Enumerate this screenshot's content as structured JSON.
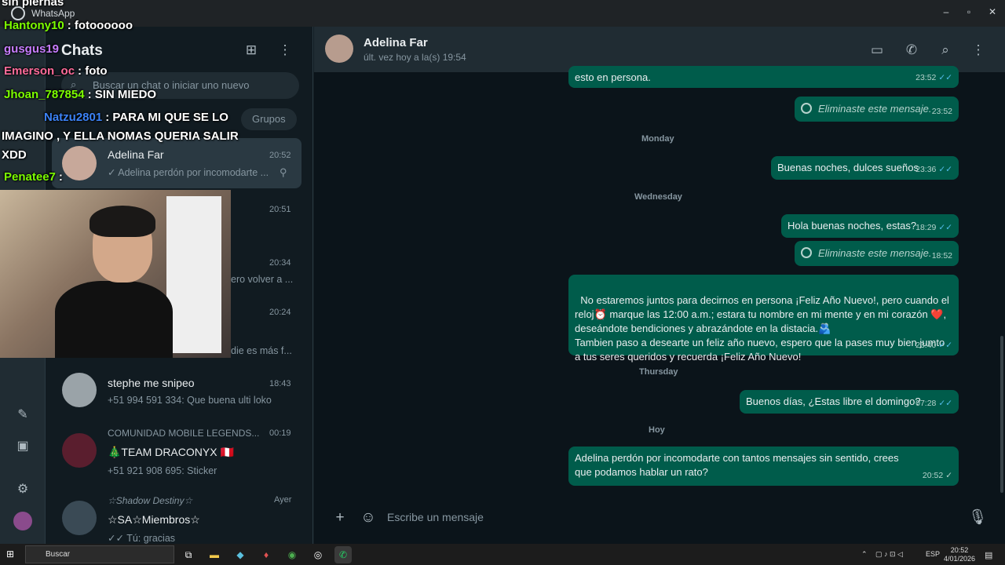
{
  "window": {
    "title": "WhatsApp"
  },
  "sidebar": {
    "title": "Chats",
    "search_placeholder": "Buscar un chat o iniciar uno nuevo",
    "filters": [
      "Grupos"
    ],
    "chats": [
      {
        "name": "Adelina Far",
        "time": "20:52",
        "last": "✓ Adelina perdón por incomodarte ...",
        "pinned": true
      },
      {
        "name": "",
        "time": "20:51",
        "last": ""
      },
      {
        "name": "",
        "time": "20:34",
        "last": "ero volver a ..."
      },
      {
        "name": "",
        "time": "20:24",
        "last": "die es más f..."
      },
      {
        "name": "stephe me snipeo",
        "time": "18:43",
        "last": "+51 994 591 334: Que buena ulti loko"
      },
      {
        "name": "COMUNIDAD MOBILE LEGENDS...",
        "time": "00:19",
        "sub": "🎄TEAM DRACONYX 🇵🇪",
        "last": "+51 921 908 695: Sticker"
      },
      {
        "name": "☆Shadow Destiny☆",
        "time": "Ayer",
        "sub": "☆SA☆Miembros☆",
        "last": "✓✓ Tú: gracias"
      }
    ]
  },
  "stream_overlay": {
    "lines": [
      {
        "user": "sin piernas",
        "text": ""
      },
      {
        "user": "Hantony10",
        "text": ": fotoooooo"
      },
      {
        "user": "gusgus19",
        "text": ""
      },
      {
        "user": "Emerson_oc",
        "text": ": foto"
      },
      {
        "user": "Jhoan_787854",
        "text": ": SIN MIEDO"
      },
      {
        "user": "Natzu2801",
        "text": ": PARA MI QUE SE LO"
      },
      {
        "user": "",
        "text": "IMAGINO , Y ELLA NOMAS QUERIA SALIR"
      },
      {
        "user": "",
        "text": "XDD"
      },
      {
        "user": "Penatee7",
        "text": ":"
      }
    ],
    "colors": {
      "Hantony10": "#7CFC00",
      "gusgus19": "#c77dff",
      "Emerson_oc": "#ff6b9a",
      "Jhoan_787854": "#7CFC00",
      "Natzu2801": "#3b82f6",
      "Penatee7": "#7CFC00"
    }
  },
  "chat": {
    "contact": "Adelina Far",
    "status": "últ. vez hoy a la(s) 19:54",
    "messages": [
      {
        "text": "esto en persona.",
        "time": "23:52",
        "ticks": "✓✓",
        "deleted": false
      },
      {
        "text": "Eliminaste este mensaje.",
        "time": "23:52",
        "deleted": true
      },
      {
        "separator": "Monday"
      },
      {
        "text": "Buenas noches, dulces sueños",
        "time": "23:36",
        "ticks": "✓✓",
        "deleted": false
      },
      {
        "separator": "Wednesday"
      },
      {
        "text": "Hola buenas noches,  estas?",
        "time": "18:29",
        "ticks": "✓✓",
        "deleted": false
      },
      {
        "text": "Eliminaste este mensaje.",
        "time": "18:52",
        "deleted": true
      },
      {
        "text": "No estaremos juntos para decirnos en persona ¡Feliz Año Nuevo!, pero cuando el reloj⏰ marque las 12:00 a.m.; estara tu nombre en mi mente y en mi corazón ❤️, deseándote bendiciones y abrazándote en la distacia.🫂\nTambien paso a desearte un feliz año nuevo, espero que la pases muy bien jumto a tus seres queridos y recuerda ¡Feliz Año Nuevo!",
        "time": "23:40",
        "ticks": "✓✓",
        "deleted": false
      },
      {
        "separator": "Thursday"
      },
      {
        "text": "Buenos días, ¿Estas libre el domingo?",
        "time": "07:28",
        "ticks": "✓✓",
        "deleted": false
      },
      {
        "separator": "Hoy"
      },
      {
        "text": "Adelina perdón por incomodarte con tantos mensajes sin sentido, crees que podamos hablar un rato?",
        "time": "20:52",
        "ticks": "✓",
        "deleted": false
      }
    ],
    "composer_placeholder": "Escribe un mensaje"
  },
  "taskbar": {
    "search_placeholder": "Buscar",
    "lang": "ESP",
    "time": "20:52",
    "date": "4/01/2026"
  }
}
